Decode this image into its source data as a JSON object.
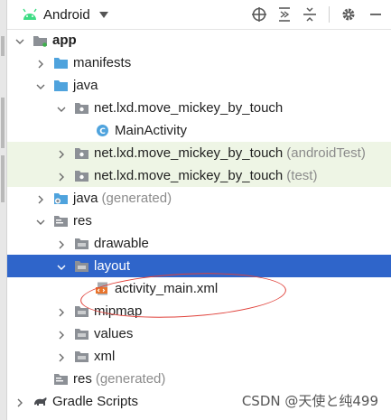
{
  "toolbar": {
    "view_mode": "Android",
    "icons": [
      "android-icon",
      "chevron-down-icon",
      "target-icon",
      "expand-all-icon",
      "collapse-all-icon",
      "gear-icon",
      "minimize-icon"
    ]
  },
  "tree": [
    {
      "name": "tree-app",
      "label": "app",
      "suffix": "",
      "depth": 0,
      "arrow": "down",
      "icon": "module-folder",
      "bold": true,
      "state": ""
    },
    {
      "name": "tree-manifests",
      "label": "manifests",
      "suffix": "",
      "depth": 1,
      "arrow": "right",
      "icon": "folder-blue",
      "bold": false,
      "state": ""
    },
    {
      "name": "tree-java",
      "label": "java",
      "suffix": "",
      "depth": 1,
      "arrow": "down",
      "icon": "folder-blue",
      "bold": false,
      "state": ""
    },
    {
      "name": "tree-package-main",
      "label": "net.lxd.move_mickey_by_touch",
      "suffix": "",
      "depth": 2,
      "arrow": "down",
      "icon": "package",
      "bold": false,
      "state": ""
    },
    {
      "name": "tree-mainactivity",
      "label": "MainActivity",
      "suffix": "",
      "depth": 3,
      "arrow": "none",
      "icon": "class",
      "bold": false,
      "state": ""
    },
    {
      "name": "tree-package-androidtest",
      "label": "net.lxd.move_mickey_by_touch",
      "suffix": "(androidTest)",
      "depth": 2,
      "arrow": "right",
      "icon": "package",
      "bold": false,
      "state": "tinted"
    },
    {
      "name": "tree-package-test",
      "label": "net.lxd.move_mickey_by_touch",
      "suffix": "(test)",
      "depth": 2,
      "arrow": "right",
      "icon": "package",
      "bold": false,
      "state": "tinted"
    },
    {
      "name": "tree-java-generated",
      "label": "java",
      "suffix": "(generated)",
      "depth": 1,
      "arrow": "right",
      "icon": "folder-generated",
      "bold": false,
      "state": ""
    },
    {
      "name": "tree-res",
      "label": "res",
      "suffix": "",
      "depth": 1,
      "arrow": "down",
      "icon": "folder-res",
      "bold": false,
      "state": ""
    },
    {
      "name": "tree-drawable",
      "label": "drawable",
      "suffix": "",
      "depth": 2,
      "arrow": "right",
      "icon": "folder-grey",
      "bold": false,
      "state": ""
    },
    {
      "name": "tree-layout",
      "label": "layout",
      "suffix": "",
      "depth": 2,
      "arrow": "down",
      "icon": "folder-grey",
      "bold": false,
      "state": "selected"
    },
    {
      "name": "tree-activity-main-xml",
      "label": "activity_main.xml",
      "suffix": "",
      "depth": 3,
      "arrow": "none",
      "icon": "layout-xml",
      "bold": false,
      "state": ""
    },
    {
      "name": "tree-mipmap",
      "label": "mipmap",
      "suffix": "",
      "depth": 2,
      "arrow": "right",
      "icon": "folder-grey",
      "bold": false,
      "state": ""
    },
    {
      "name": "tree-values",
      "label": "values",
      "suffix": "",
      "depth": 2,
      "arrow": "right",
      "icon": "folder-grey",
      "bold": false,
      "state": ""
    },
    {
      "name": "tree-xml",
      "label": "xml",
      "suffix": "",
      "depth": 2,
      "arrow": "right",
      "icon": "folder-grey",
      "bold": false,
      "state": ""
    },
    {
      "name": "tree-res-generated",
      "label": "res",
      "suffix": "(generated)",
      "depth": 1,
      "arrow": "none",
      "icon": "folder-res",
      "bold": false,
      "state": ""
    },
    {
      "name": "tree-gradle-scripts",
      "label": "Gradle Scripts",
      "suffix": "",
      "depth": 0,
      "arrow": "right",
      "icon": "gradle",
      "bold": false,
      "state": ""
    }
  ],
  "watermark": "CSDN @天使と纯499",
  "colors": {
    "selection": "#2f65ca",
    "tint": "#eef5e5",
    "folder_blue": "#4fa3dd",
    "package": "#8c9096",
    "annotation": "#e0413a"
  }
}
